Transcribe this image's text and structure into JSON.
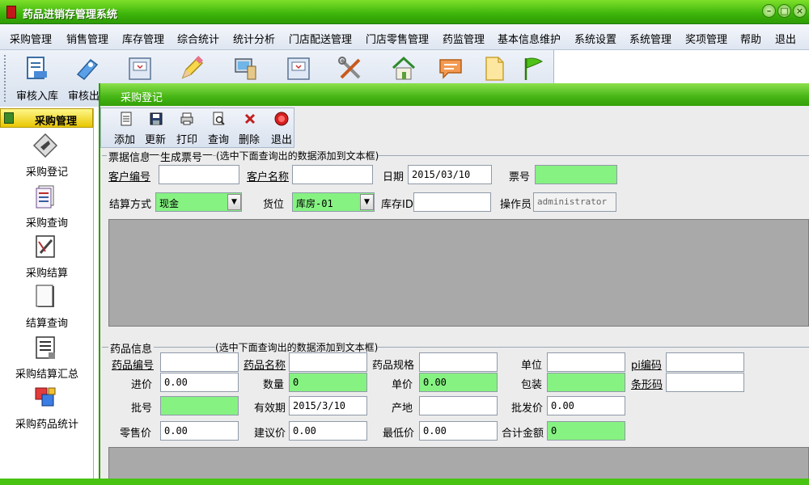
{
  "window": {
    "title": "药品进销存管理系统",
    "controls": [
      "–",
      "□",
      "×"
    ]
  },
  "menu": [
    "采购管理",
    "销售管理",
    "库存管理",
    "综合统计",
    "统计分析",
    "门店配送管理",
    "门店零售管理",
    "药监管理",
    "基本信息维护",
    "系统设置",
    "系统管理",
    "奖项管理",
    "帮助",
    "退出"
  ],
  "toolbar": {
    "labels": [
      "审核入库",
      "审核出"
    ]
  },
  "sidebar": {
    "header": "采购管理",
    "items": [
      "采购登记",
      "采购查询",
      "采购结算",
      "结算查询",
      "采购结算汇总",
      "采购药品统计"
    ]
  },
  "child": {
    "title": "采购登记",
    "toolbar": [
      "添加",
      "更新",
      "打印",
      "查询",
      "删除",
      "退出"
    ],
    "group1": {
      "title": "票据信息",
      "subtitle": "生成票号",
      "hint": "(选中下面查询出的数据添加到文本框)",
      "customer_id": {
        "label": "客户编号",
        "value": ""
      },
      "customer_name": {
        "label": "客户名称",
        "value": ""
      },
      "date": {
        "label": "日期",
        "value": "2015/03/10"
      },
      "ticket_no": {
        "label": "票号",
        "value": ""
      },
      "settle_method": {
        "label": "结算方式",
        "value": "现金"
      },
      "location": {
        "label": "货位",
        "value": "库房-01"
      },
      "stock_id": {
        "label": "库存ID",
        "value": ""
      },
      "operator": {
        "label": "操作员",
        "value": "administrator"
      }
    },
    "group2": {
      "title": "药品信息",
      "hint": "(选中下面查询出的数据添加到文本框)",
      "drug_id": {
        "label": "药品编号",
        "value": ""
      },
      "drug_name": {
        "label": "药品名称",
        "value": ""
      },
      "drug_spec": {
        "label": "药品规格",
        "value": ""
      },
      "unit": {
        "label": "单位",
        "value": ""
      },
      "pi_code": {
        "label": "pi编码",
        "value": ""
      },
      "purchase_price": {
        "label": "进价",
        "value": "0.00"
      },
      "quantity": {
        "label": "数量",
        "value": "0"
      },
      "unit_price": {
        "label": "单价",
        "value": "0.00"
      },
      "packaging": {
        "label": "包装",
        "value": ""
      },
      "barcode": {
        "label": "条形码",
        "value": ""
      },
      "batch_no": {
        "label": "批号",
        "value": ""
      },
      "expiry": {
        "label": "有效期",
        "value": "2015/3/10"
      },
      "origin": {
        "label": "产地",
        "value": ""
      },
      "wholesale_price": {
        "label": "批发价",
        "value": "0.00"
      },
      "retail_price": {
        "label": "零售价",
        "value": "0.00"
      },
      "suggested_price": {
        "label": "建议价",
        "value": "0.00"
      },
      "min_price": {
        "label": "最低价",
        "value": "0.00"
      },
      "total_amount": {
        "label": "合计金额",
        "value": "0"
      }
    }
  }
}
